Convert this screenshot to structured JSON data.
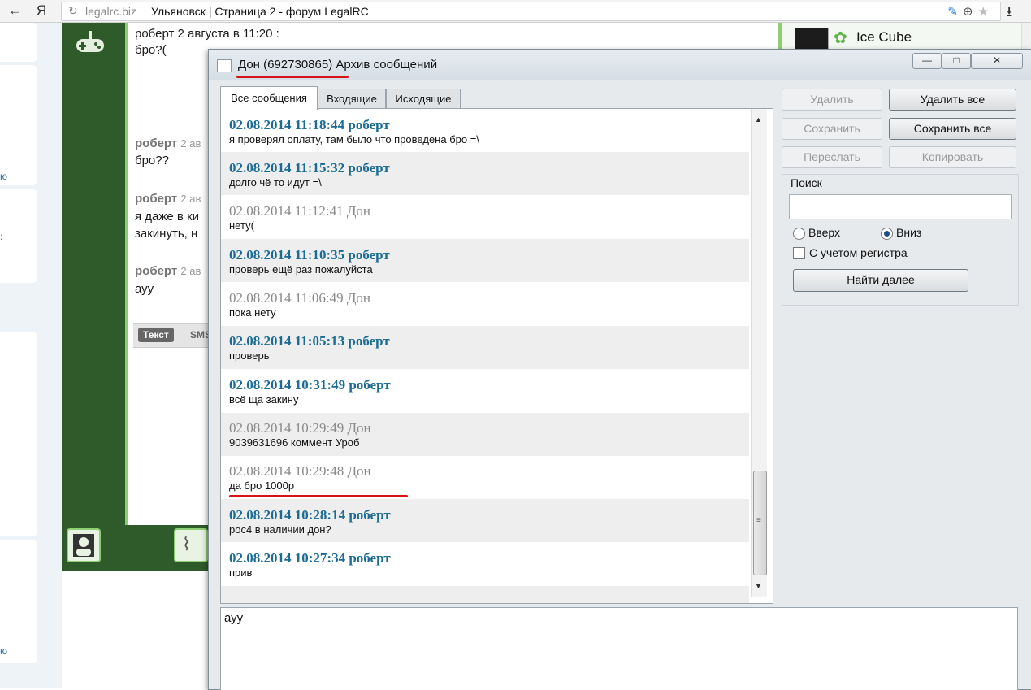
{
  "browser": {
    "domain": "legalrc.biz",
    "tab_title": "Ульяновск | Страница 2 - форум LegalRC"
  },
  "left_page": {
    "snippets": [
      "ю",
      ":",
      "ю"
    ]
  },
  "background_chat": {
    "messages": [
      {
        "name": "роберт",
        "time": "2 августа в 11:20 :",
        "text": "бро?("
      },
      {
        "name": "роберт",
        "time": "2 ав",
        "text": "бро??"
      },
      {
        "name": "роберт",
        "time": "2 ав",
        "text": "я даже в ки"
      },
      {
        "name": "",
        "time": "",
        "text": "закинуть, н"
      },
      {
        "name": "роберт",
        "time": "2 ав",
        "text": "ауу"
      }
    ],
    "tabs": {
      "text": "Текст",
      "sms": "SMS"
    }
  },
  "background_contact": {
    "name": "Ice Cube"
  },
  "dialog": {
    "title_name": "Дон (692730865)",
    "title_rest": "Архив сообщений",
    "window_buttons": {
      "minimize": "—",
      "maximize": "□",
      "close": "✕"
    },
    "tabs": [
      "Все сообщения",
      "Входящие",
      "Исходящие"
    ],
    "messages": [
      {
        "head": "02.08.2014 11:18:44 роберт",
        "body": "я проверял оплату, там было что проведена бро =\\",
        "sender": "rob"
      },
      {
        "head": "02.08.2014 11:15:32 роберт",
        "body": "долго чё то идут =\\",
        "sender": "rob"
      },
      {
        "head": "02.08.2014 11:12:41 Дон",
        "body": "нету(",
        "sender": "don"
      },
      {
        "head": "02.08.2014 11:10:35 роберт",
        "body": "проверь ещё раз пожалуйста",
        "sender": "rob"
      },
      {
        "head": "02.08.2014 11:06:49 Дон",
        "body": "пока нету",
        "sender": "don"
      },
      {
        "head": "02.08.2014 11:05:13 роберт",
        "body": "проверь",
        "sender": "rob"
      },
      {
        "head": "02.08.2014 10:31:49 роберт",
        "body": "всё ща закину",
        "sender": "rob"
      },
      {
        "head": "02.08.2014 10:29:49 Дон",
        "body": "9039631696 коммент Уроб",
        "sender": "don"
      },
      {
        "head": "02.08.2014 10:29:48 Дон",
        "body": "да бро 1000р",
        "sender": "don"
      },
      {
        "head": "02.08.2014 10:28:14 роберт",
        "body": "рос4 в наличии дон?",
        "sender": "rob"
      },
      {
        "head": "02.08.2014 10:27:34 роберт",
        "body": "прив",
        "sender": "rob"
      }
    ],
    "buttons": {
      "delete": "Удалить",
      "delete_all": "Удалить все",
      "save": "Сохранить",
      "save_all": "Сохранить все",
      "forward": "Переслать",
      "copy": "Копировать"
    },
    "search": {
      "label": "Поиск",
      "value": "",
      "up": "Вверх",
      "down": "Вниз",
      "selected": "down",
      "case_sensitive": "С учетом регистра",
      "find_next": "Найти далее"
    },
    "input_text": "ауу"
  }
}
